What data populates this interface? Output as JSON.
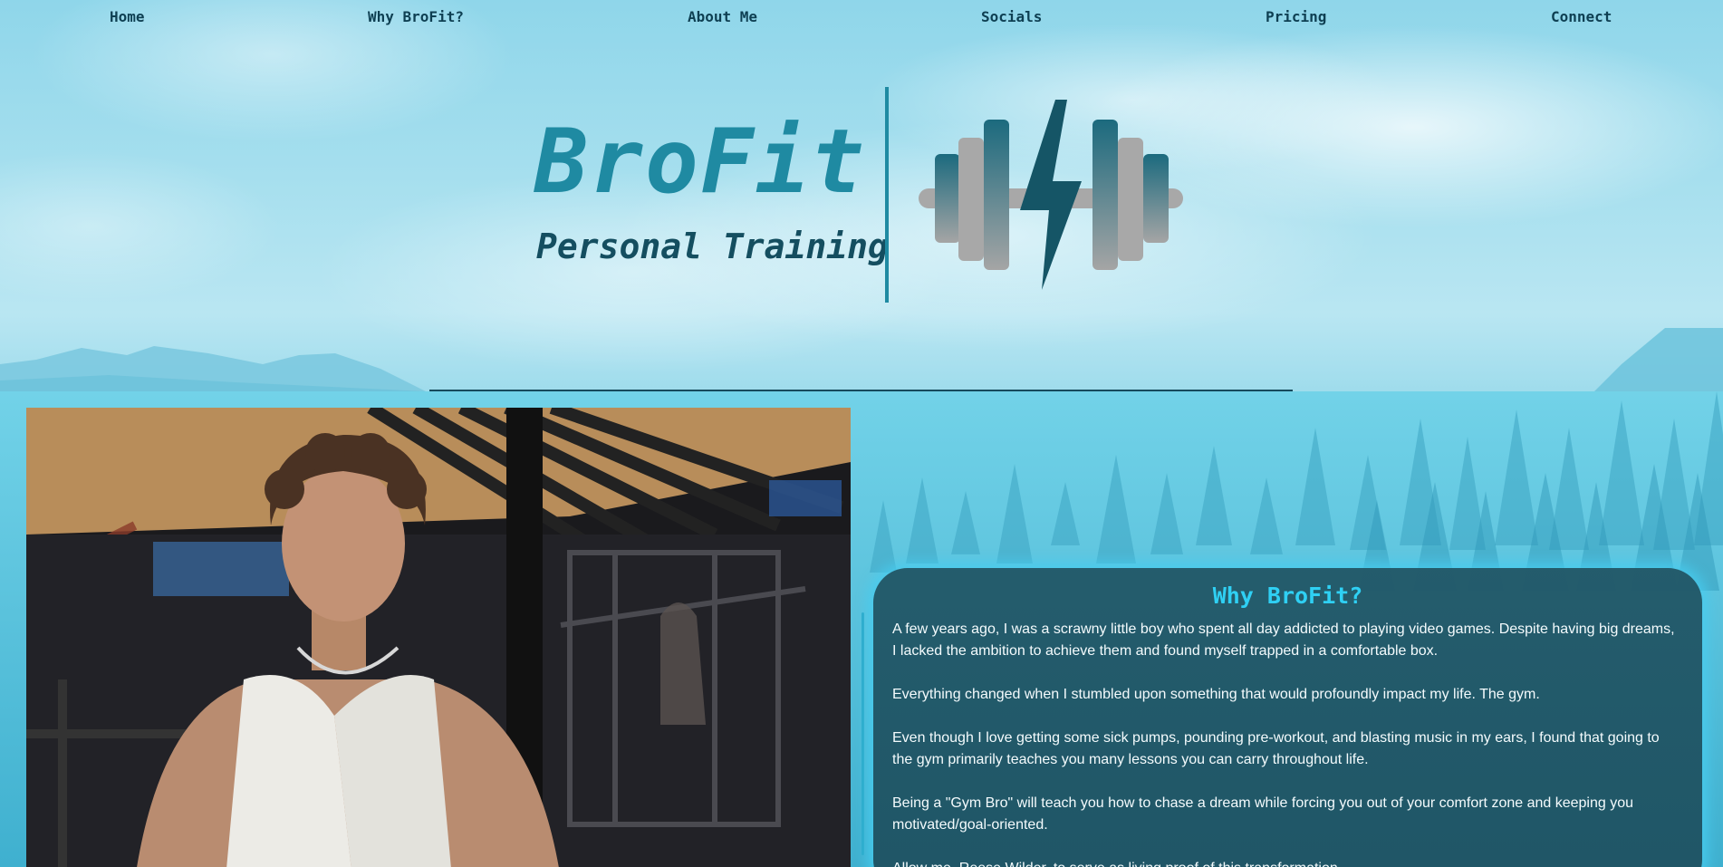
{
  "nav": {
    "items": [
      {
        "label": "Home"
      },
      {
        "label": "Why BroFit?"
      },
      {
        "label": "About Me"
      },
      {
        "label": "Socials"
      },
      {
        "label": "Pricing"
      },
      {
        "label": "Connect"
      }
    ]
  },
  "brand": {
    "title": "BroFit",
    "subtitle": "Personal Training",
    "logo_icon": "dumbbell-lightning-icon"
  },
  "colors": {
    "brand_teal": "#1f8aa2",
    "dark_teal": "#144e60",
    "card_bg": "#225868",
    "card_title": "#2fd0f4",
    "glow": "#46cdf0"
  },
  "about_photo": {
    "alt": "gym-photo"
  },
  "why": {
    "title": "Why BroFit?",
    "paragraphs": [
      "A few years ago, I was a scrawny little boy who spent all day addicted to playing video games. Despite having big dreams, I lacked the ambition to achieve them and found myself trapped in a comfortable box.",
      "Everything changed when I stumbled upon something that would profoundly impact my life. The gym.",
      "Even though I love getting some sick pumps, pounding pre-workout, and blasting music in my ears, I found that going to the gym primarily teaches you many lessons you can carry throughout life.",
      "Being a \"Gym Bro\" will teach you how to chase a dream while forcing you out of your comfort zone and keeping you motivated/goal-oriented.",
      "Allow me, Reese Wilder, to serve as living proof of this transformation."
    ]
  }
}
